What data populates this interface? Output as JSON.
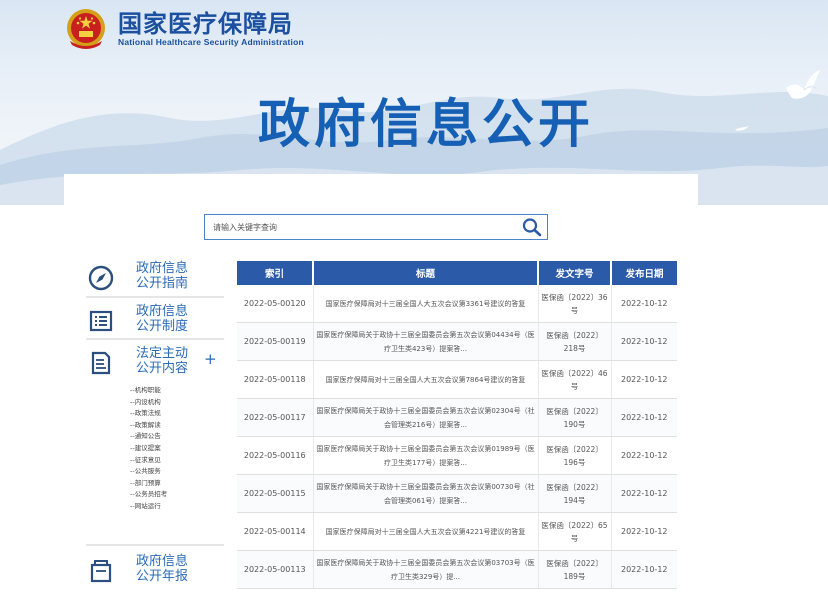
{
  "header": {
    "agency_cn": "国家医疗保障局",
    "agency_en": "National Healthcare Security Administration",
    "page_title": "政府信息公开"
  },
  "search": {
    "placeholder": "请输入关键字查询",
    "icon": "search-icon"
  },
  "sidebar": {
    "items": [
      {
        "label": "政府信息\n公开指南",
        "icon": "compass-icon"
      },
      {
        "label": "政府信息\n公开制度",
        "icon": "list-document-icon"
      },
      {
        "label": "法定主动\n公开内容",
        "icon": "edit-document-icon",
        "expand": "+"
      },
      {
        "label": "政府信息\n公开年报",
        "icon": "report-icon"
      }
    ],
    "subitems": [
      "--机构职能",
      "--内设机构",
      "--政策法规",
      "--政策解读",
      "--通知公告",
      "--建议提案",
      "--征求意见",
      "--公共服务",
      "--部门预算",
      "--公务员招考",
      "--网站运行"
    ]
  },
  "table": {
    "headers": [
      "索引",
      "标题",
      "发文字号",
      "发布日期"
    ],
    "rows": [
      {
        "index": "2022-05-00120",
        "title": "国家医疗保障局对十三届全国人大五次会议第3361号建议的答复",
        "doc": "医保函〔2022〕36号",
        "date": "2022-10-12"
      },
      {
        "index": "2022-05-00119",
        "title": "国家医疗保障局关于政协十三届全国委员会第五次会议第04434号（医疗卫生类423号）提案答...",
        "doc": "医保函〔2022〕218号",
        "date": "2022-10-12"
      },
      {
        "index": "2022-05-00118",
        "title": "国家医疗保障局对十三届全国人大五次会议第7864号建议的答复",
        "doc": "医保函〔2022〕46号",
        "date": "2022-10-12"
      },
      {
        "index": "2022-05-00117",
        "title": "国家医疗保障局关于政协十三届全国委员会第五次会议第02304号（社会管理类216号）提案答...",
        "doc": "医保函〔2022〕190号",
        "date": "2022-10-12"
      },
      {
        "index": "2022-05-00116",
        "title": "国家医疗保障局关于政协十三届全国委员会第五次会议第01989号（医疗卫生类177号）提案答...",
        "doc": "医保函〔2022〕196号",
        "date": "2022-10-12"
      },
      {
        "index": "2022-05-00115",
        "title": "国家医疗保障局关于政协十三届全国委员会第五次会议第00730号（社会管理类061号）提案答...",
        "doc": "医保函〔2022〕194号",
        "date": "2022-10-12"
      },
      {
        "index": "2022-05-00114",
        "title": "国家医疗保障局对十三届全国人大五次会议第4221号建议的答复",
        "doc": "医保函〔2022〕65号",
        "date": "2022-10-12"
      },
      {
        "index": "2022-05-00113",
        "title": "国家医疗保障局关于政协十三届全国委员会第五次会议第03703号（医疗卫生类329号）提...",
        "doc": "医保函〔2022〕189号",
        "date": "2022-10-12"
      }
    ]
  },
  "colors": {
    "brand_blue": "#1b4fa0",
    "title_blue": "#1560b5",
    "table_header": "#2a5aa8",
    "side_label": "#2a6bb5"
  }
}
